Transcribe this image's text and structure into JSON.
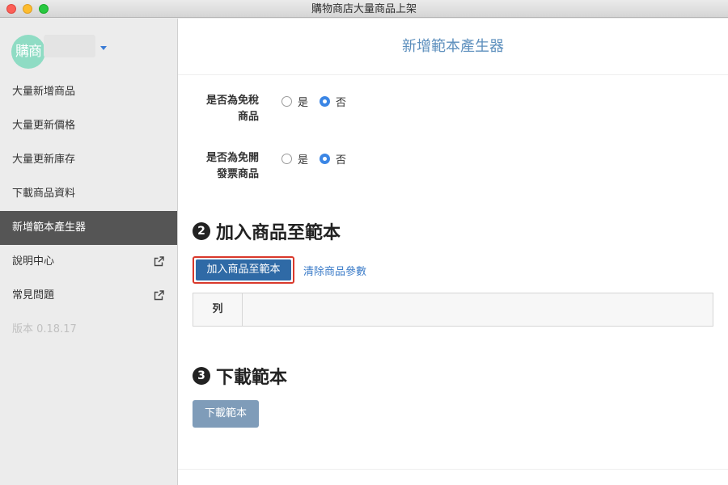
{
  "window": {
    "title": "購物商店大量商品上架"
  },
  "sidebar": {
    "avatar_text": "購商",
    "items": [
      {
        "label": "大量新增商品",
        "external": false
      },
      {
        "label": "大量更新價格",
        "external": false
      },
      {
        "label": "大量更新庫存",
        "external": false
      },
      {
        "label": "下載商品資料",
        "external": false
      },
      {
        "label": "新增範本產生器",
        "external": false,
        "active": true
      },
      {
        "label": "說明中心",
        "external": true
      },
      {
        "label": "常見問題",
        "external": true
      }
    ],
    "version": "版本 0.18.17"
  },
  "main": {
    "header_title": "新增範本產生器",
    "tax_free": {
      "label_line1": "是否為免稅",
      "label_line2": "商品",
      "yes": "是",
      "no": "否",
      "selected": "no"
    },
    "invoice_free": {
      "label_line1": "是否為免開",
      "label_line2": "發票商品",
      "yes": "是",
      "no": "否",
      "selected": "no"
    },
    "section2": {
      "number": "2",
      "title": "加入商品至範本"
    },
    "add_button": "加入商品至範本",
    "clear_link": "清除商品參數",
    "table": {
      "col1": "列"
    },
    "section3": {
      "number": "3",
      "title": "下載範本"
    },
    "download_button": "下載範本"
  },
  "colors": {
    "accent": "#3b86e5",
    "active_nav": "#555555",
    "primary_button": "#2f6aa6",
    "highlight_border": "#d9382b",
    "disabled_button": "#7f9cb9"
  },
  "icons": {
    "external_link": "external-link-icon",
    "dropdown": "caret-down-icon"
  }
}
